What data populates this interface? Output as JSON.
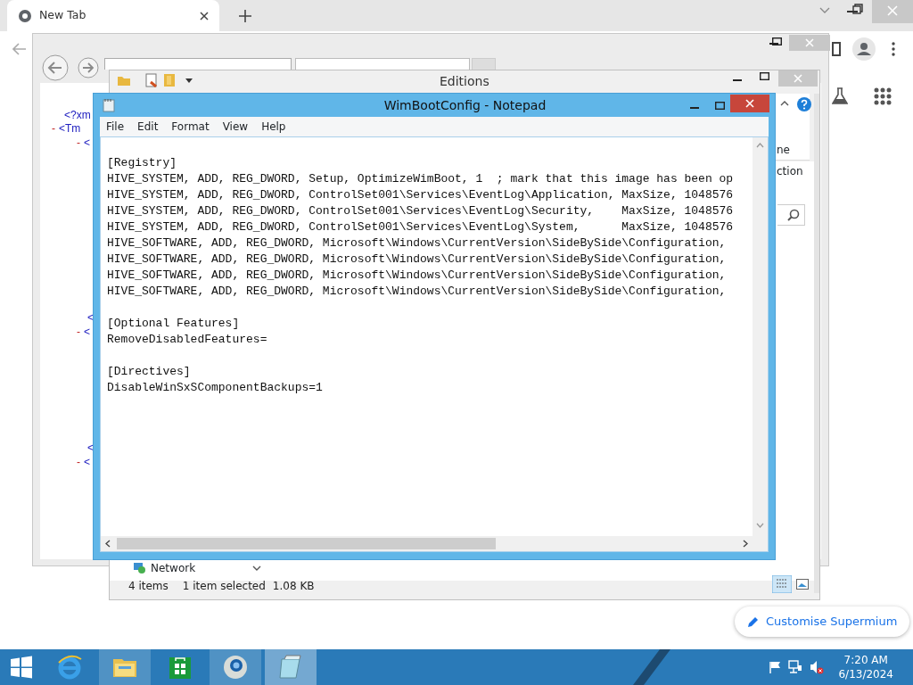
{
  "browser": {
    "tabs": [
      {
        "title": "New Tab",
        "selected": true
      }
    ],
    "customize_button": "Customise Supermium"
  },
  "ie_window": {
    "xml_lines": [
      {
        "tag": "<?xm"
      },
      {
        "toggle": "-",
        "tag": "<Tm"
      },
      {
        "toggle": "-",
        "tag": "<"
      },
      {
        "tag": "<"
      },
      {
        "toggle": "-",
        "tag": "<"
      },
      {
        "tag": "<"
      },
      {
        "toggle": "-",
        "tag": "<"
      }
    ]
  },
  "explorer": {
    "title": "Editions",
    "ribbon_fragments": [
      "ne",
      "ction"
    ],
    "nav_item": "Network",
    "status": {
      "items": "4 items",
      "selection": "1 item selected",
      "size": "1.08 KB"
    }
  },
  "notepad": {
    "title": "WimBootConfig - Notepad",
    "menu": [
      "File",
      "Edit",
      "Format",
      "View",
      "Help"
    ],
    "sections": [
      [
        "[Registry]",
        "HIVE_SYSTEM, ADD, REG_DWORD, Setup, OptimizeWimBoot, 1  ; mark that this image has been op",
        "HIVE_SYSTEM, ADD, REG_DWORD, ControlSet001\\Services\\EventLog\\Application, MaxSize, 1048576",
        "HIVE_SYSTEM, ADD, REG_DWORD, ControlSet001\\Services\\EventLog\\Security,    MaxSize, 1048576",
        "HIVE_SYSTEM, ADD, REG_DWORD, ControlSet001\\Services\\EventLog\\System,      MaxSize, 1048576",
        "HIVE_SOFTWARE, ADD, REG_DWORD, Microsoft\\Windows\\CurrentVersion\\SideBySide\\Configuration,",
        "HIVE_SOFTWARE, ADD, REG_DWORD, Microsoft\\Windows\\CurrentVersion\\SideBySide\\Configuration,",
        "HIVE_SOFTWARE, ADD, REG_DWORD, Microsoft\\Windows\\CurrentVersion\\SideBySide\\Configuration,",
        "HIVE_SOFTWARE, ADD, REG_DWORD, Microsoft\\Windows\\CurrentVersion\\SideBySide\\Configuration,"
      ],
      [
        "[Optional Features]",
        "RemoveDisabledFeatures="
      ],
      [
        "[Directives]",
        "DisableWinSxSComponentBackups=1"
      ]
    ]
  },
  "taskbar": {
    "apps": [
      {
        "kind": "ie",
        "running": false,
        "selected": false
      },
      {
        "kind": "explorer",
        "running": true,
        "selected": false
      },
      {
        "kind": "store",
        "running": false,
        "selected": false
      },
      {
        "kind": "browser",
        "running": true,
        "selected": false
      },
      {
        "kind": "notepad",
        "running": true,
        "selected": true
      }
    ],
    "time": "7:20 AM",
    "date": "6/13/2024"
  }
}
